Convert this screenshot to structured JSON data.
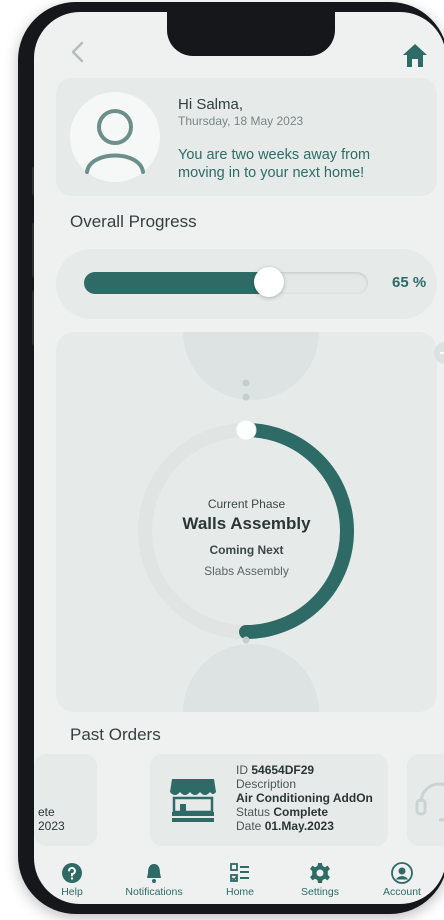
{
  "header": {
    "back_icon": "chevron-left-icon",
    "home_icon": "home-icon"
  },
  "greeting": {
    "title": "Hi Salma,",
    "date": "Thursday, 18 May 2023",
    "message": "You are two weeks away from moving in to your next home!"
  },
  "progress": {
    "title": "Overall Progress",
    "value": 65,
    "value_label": "65 %"
  },
  "phase": {
    "current_label": "Current Phase",
    "current_value": "Walls Assembly",
    "next_label": "Coming Next",
    "next_value": "Slabs Assembly",
    "progress": 0.5
  },
  "orders": {
    "title": "Past Orders",
    "prev_card": {
      "line1": "ete",
      "line2": "2023"
    },
    "main_card": {
      "id_label": "ID",
      "id_value": "54654DF29",
      "desc_label": "Description",
      "desc_value": "Air Conditioning AddOn",
      "status_label": "Status",
      "status_value": "Complete",
      "date_label": "Date",
      "date_value": "01.May.2023",
      "icon": "storefront-icon"
    },
    "next_card": {
      "icon": "headset-icon"
    }
  },
  "tabs": [
    {
      "label": "Help",
      "icon": "help-icon"
    },
    {
      "label": "Notifications",
      "icon": "bell-icon"
    },
    {
      "label": "Home",
      "icon": "checklist-icon"
    },
    {
      "label": "Settings",
      "icon": "gear-icon"
    },
    {
      "label": "Account",
      "icon": "user-icon"
    }
  ],
  "colors": {
    "accent": "#2e6b66",
    "card": "#e6ebea",
    "screen": "#eef1f0"
  }
}
